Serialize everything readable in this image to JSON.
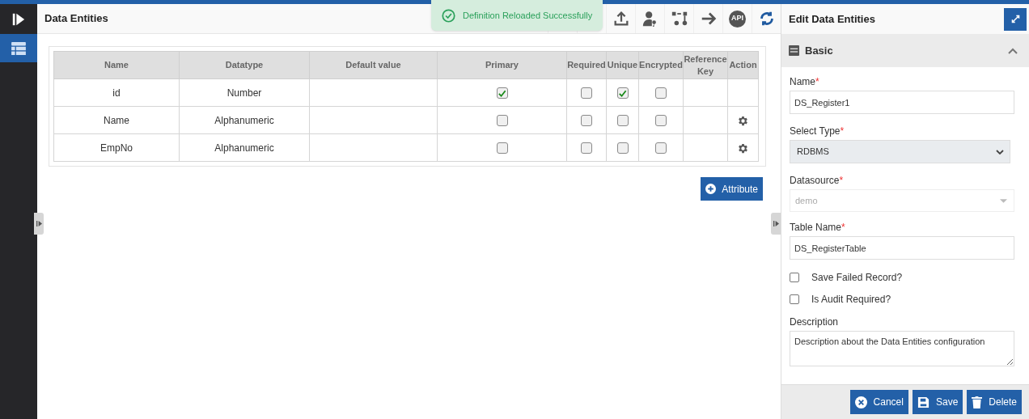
{
  "page_title": "Data Entities",
  "toast": {
    "message": "Definition Reloaded Successfully"
  },
  "toolbar": [
    {
      "kind": "upload"
    },
    {
      "kind": "user-key"
    },
    {
      "kind": "diagram"
    },
    {
      "kind": "arrow"
    },
    {
      "kind": "api",
      "label": "API"
    },
    {
      "kind": "refresh"
    }
  ],
  "sidebar": {
    "items": [
      {
        "kind": "table",
        "selected": true
      }
    ]
  },
  "table": {
    "columns": [
      "Name",
      "Datatype",
      "Default value",
      "Primary",
      "Required",
      "Unique",
      "Encrypted",
      "Reference Key",
      "Action"
    ],
    "rows": [
      {
        "name": "id",
        "datatype": "Number",
        "default_value": "",
        "primary": true,
        "required": false,
        "unique": true,
        "encrypted": false,
        "has_action": false
      },
      {
        "name": "Name",
        "datatype": "Alphanumeric",
        "default_value": "",
        "primary": false,
        "required": false,
        "unique": false,
        "encrypted": false,
        "has_action": true
      },
      {
        "name": "EmpNo",
        "datatype": "Alphanumeric",
        "default_value": "",
        "primary": false,
        "required": false,
        "unique": false,
        "encrypted": false,
        "has_action": true
      }
    ]
  },
  "add_button": "Attribute",
  "panel": {
    "title": "Edit Data Entities",
    "section": {
      "title": "Basic",
      "expanded": true
    },
    "fields": [
      {
        "kind": "input",
        "label": "Name",
        "required_mark": "*",
        "value": "DS_Register1"
      },
      {
        "kind": "select",
        "label": "Select Type",
        "required_mark": "*",
        "value": "RDBMS"
      },
      {
        "kind": "disabled-select",
        "label": "Datasource",
        "required_mark": "*",
        "value": "demo",
        "disabled": true
      },
      {
        "kind": "input",
        "label": "Table Name",
        "required_mark": "*",
        "value": "DS_RegisterTable"
      },
      {
        "kind": "checkbox",
        "label": "Save Failed Record?",
        "checked": false
      },
      {
        "kind": "checkbox",
        "label": "Is Audit Required?",
        "checked": false
      },
      {
        "kind": "textarea",
        "label": "Description",
        "value": "Description about the Data Entities configuration"
      }
    ],
    "buttons": [
      {
        "kind": "cancel",
        "label": "Cancel"
      },
      {
        "kind": "save",
        "label": "Save"
      },
      {
        "kind": "delete",
        "label": "Delete"
      }
    ]
  }
}
